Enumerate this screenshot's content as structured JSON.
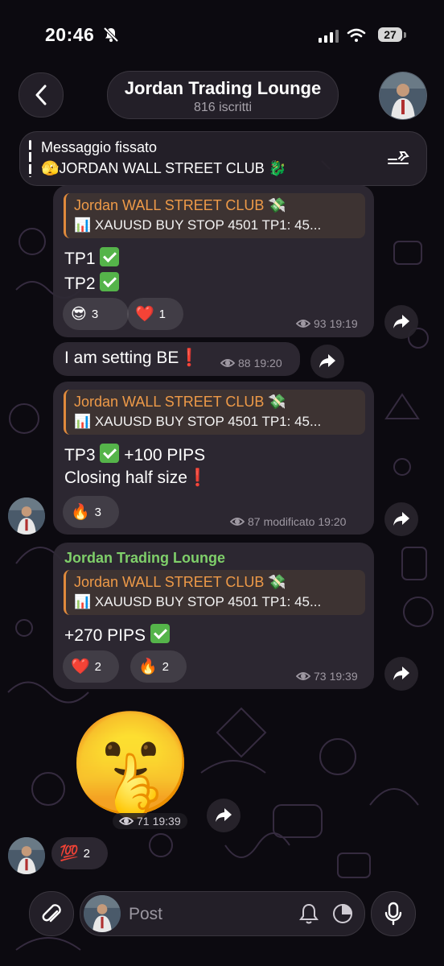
{
  "status_bar": {
    "time": "20:46",
    "battery": "27"
  },
  "header": {
    "title": "Jordan Trading Lounge",
    "subtitle": "816 iscritti"
  },
  "pinned": {
    "title": "Messaggio fissato",
    "text": "🫣JORDAN WALL STREET CLUB 🐉"
  },
  "messages": [
    {
      "quote_title": "Jordan WALL STREET CLUB 💸",
      "quote_text": "📊 XAUUSD BUY STOP 4501 TP1: 45...",
      "lines": [
        "TP1",
        "TP2"
      ],
      "reactions": [
        {
          "emoji": "😎",
          "count": "3"
        },
        {
          "emoji": "❤️",
          "count": "1"
        }
      ],
      "views": "93",
      "time": "19:19"
    },
    {
      "text": "I am setting BE",
      "views": "88",
      "time": "19:20"
    },
    {
      "quote_title": "Jordan WALL STREET CLUB 💸",
      "quote_text": "📊 XAUUSD BUY STOP 4501 TP1: 45...",
      "line1": "TP3",
      "line1_suffix": "+100 PIPS",
      "line2": "Closing half size",
      "reactions": [
        {
          "emoji": "🔥",
          "count": "3"
        }
      ],
      "views": "87",
      "edited": "modificato",
      "time": "19:20"
    },
    {
      "sender": "Jordan Trading Lounge",
      "quote_title": "Jordan WALL STREET CLUB 💸",
      "quote_text": "📊 XAUUSD BUY STOP 4501 TP1: 45...",
      "text": "+270 PIPS",
      "reactions": [
        {
          "emoji": "❤️",
          "count": "2"
        },
        {
          "emoji": "🔥",
          "count": "2"
        }
      ],
      "views": "73",
      "time": "19:39"
    },
    {
      "sticker": "🤫",
      "views": "71",
      "time": "19:39",
      "reactions": [
        {
          "emoji": "💯",
          "count": "2"
        }
      ]
    }
  ],
  "composer": {
    "placeholder": "Post"
  },
  "colors": {
    "accent_green": "#7fcf6a",
    "quote_orange": "#ee9a48",
    "alert_red": "#e0302a"
  },
  "icons": [
    "bell-slash-icon",
    "signal-icon",
    "wifi-icon",
    "back-chevron-icon",
    "pin-list-icon",
    "eye-icon",
    "share-arrow-icon",
    "paperclip-icon",
    "bell-icon",
    "timer-icon",
    "microphone-icon"
  ]
}
